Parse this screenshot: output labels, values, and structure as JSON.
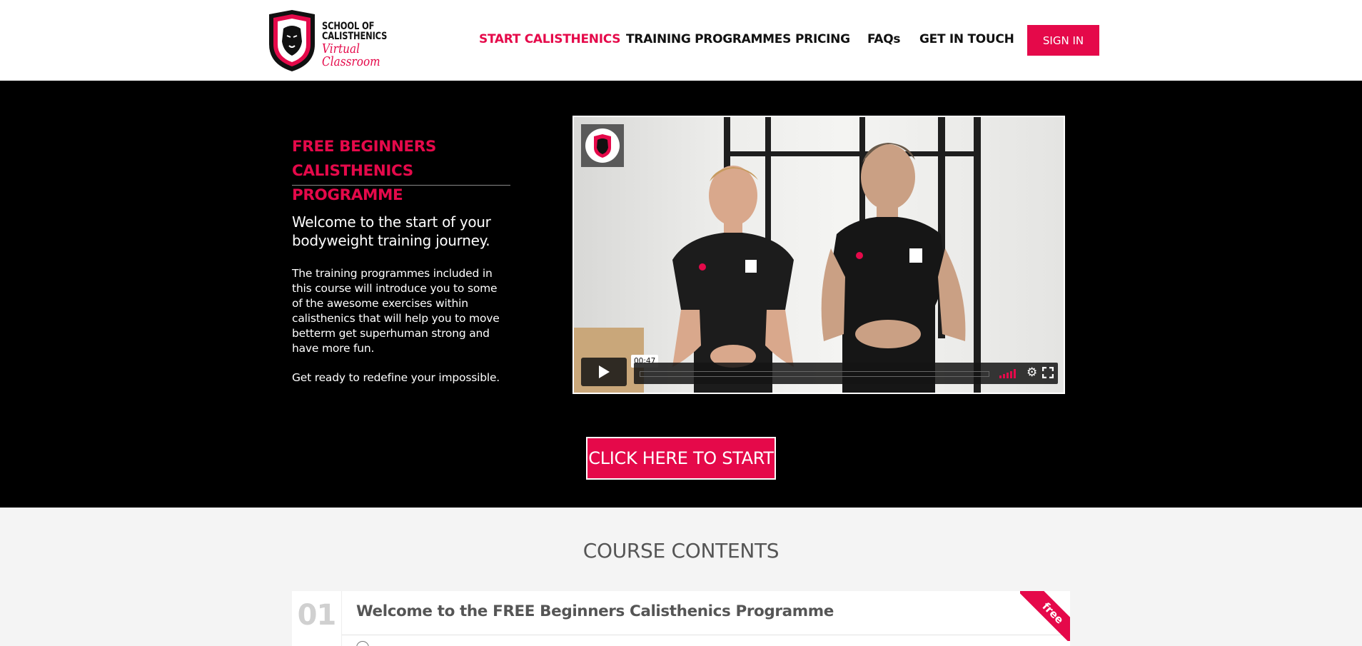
{
  "header": {
    "logo": {
      "line1": "SCHOOL OF",
      "line2": "CALISTHENICS",
      "script": "Virtual Classroom"
    },
    "nav": [
      {
        "label": "START CALISTHENICS",
        "active": true
      },
      {
        "label": "TRAINING PROGRAMMES",
        "active": false
      },
      {
        "label": "PRICING",
        "active": false
      },
      {
        "label": "FAQs",
        "active": false
      },
      {
        "label": "GET IN TOUCH",
        "active": false
      }
    ],
    "signin_label": "SIGN IN"
  },
  "hero": {
    "title": "FREE BEGINNERS CALISTHENICS PROGRAMME",
    "lead": "Welcome to the start of your bodyweight training journey.",
    "body": "The training programmes included in this course will introduce you to some of the awesome exercises within calisthenics that will help you to move betterm get superhuman strong and have more fun.",
    "body2": "Get ready to redefine your impossible.",
    "video": {
      "time": "00:47",
      "icons": [
        "play-icon",
        "volume-icon",
        "settings-gear-icon",
        "fullscreen-icon"
      ]
    },
    "cta_label": "CLICK HERE TO START"
  },
  "contents": {
    "title": "COURSE CONTENTS",
    "lessons": [
      {
        "number": "01",
        "title": "Welcome to the FREE Beginners Calisthenics Programme",
        "badge": "free"
      }
    ]
  },
  "colors": {
    "accent": "#e5094a",
    "hero_bg": "#000000",
    "contents_bg": "#f4f4f4"
  }
}
